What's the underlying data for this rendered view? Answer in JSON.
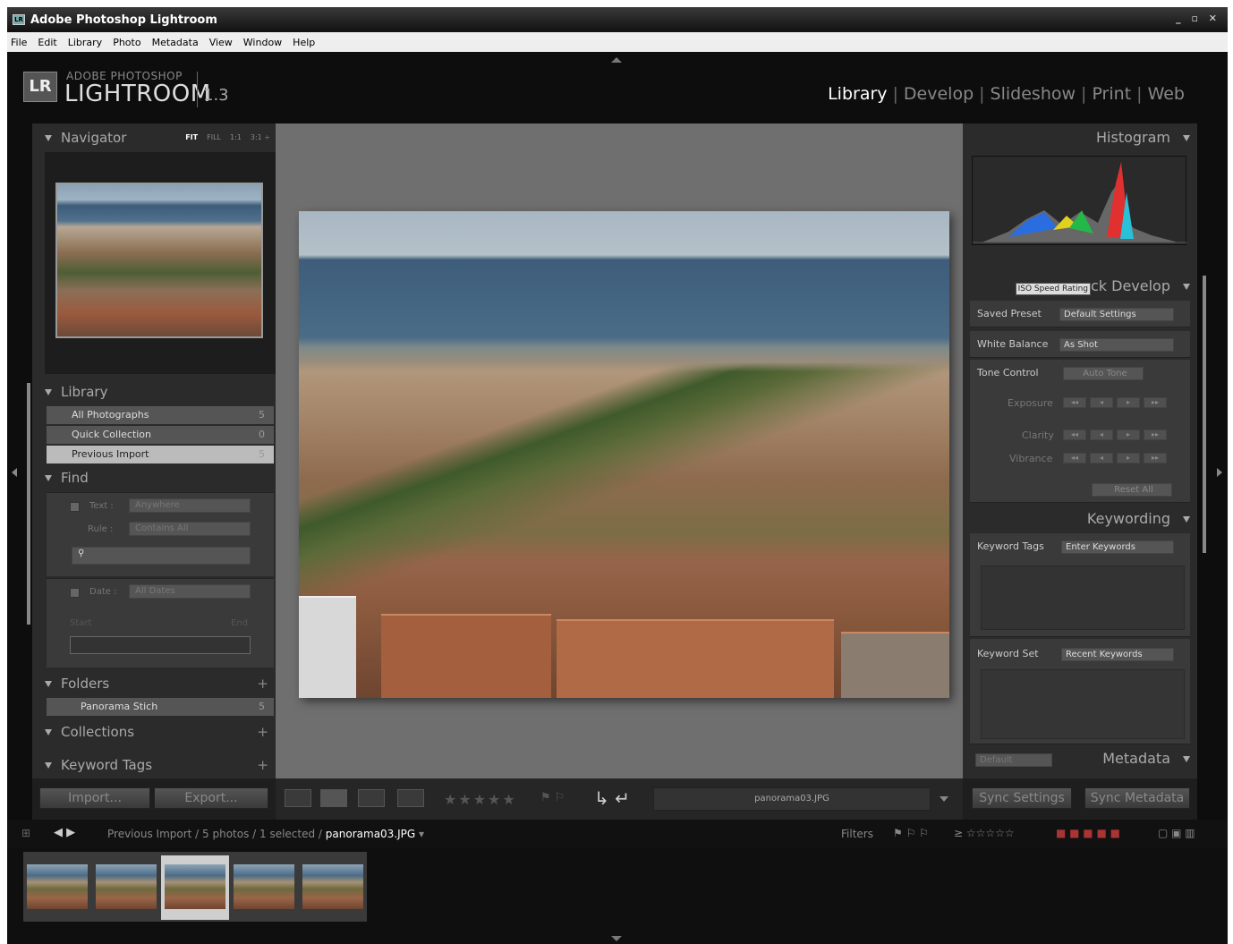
{
  "window": {
    "title": "Adobe Photoshop Lightroom",
    "app_icon_text": "LR",
    "controls": "_ ▫ ✕"
  },
  "menubar": [
    "File",
    "Edit",
    "Library",
    "Photo",
    "Metadata",
    "View",
    "Window",
    "Help"
  ],
  "header": {
    "logo_box": "LR",
    "logo_small": "ADOBE PHOTOSHOP",
    "logo_big": "LIGHTROOM",
    "version": "1.3",
    "modules": [
      "Library",
      "Develop",
      "Slideshow",
      "Print",
      "Web"
    ],
    "active_module": "Library",
    "separator": "|"
  },
  "left_panel": {
    "navigator": {
      "title": "Navigator",
      "options": [
        "FIT",
        "FILL",
        "1:1",
        "3:1 ÷"
      ]
    },
    "library": {
      "title": "Library",
      "items": [
        {
          "label": "All Photographs",
          "count": "5"
        },
        {
          "label": "Quick Collection",
          "count": "0"
        },
        {
          "label": "Previous Import",
          "count": "5"
        }
      ],
      "selected_index": 2
    },
    "find": {
      "title": "Find",
      "text_label": "Text :",
      "text_value": "Anywhere",
      "rule_label": "Rule :",
      "rule_value": "Contains All",
      "date_label": "Date :",
      "date_value": "All Dates",
      "start_label": "Start",
      "end_label": "End"
    },
    "folders": {
      "title": "Folders",
      "items": [
        {
          "label": "Panorama Stich",
          "count": "5"
        }
      ]
    },
    "collections": {
      "title": "Collections"
    },
    "keyword_tags": {
      "title": "Keyword Tags"
    },
    "plus": "+",
    "import_label": "Import...",
    "export_label": "Export..."
  },
  "toolbar": {
    "stars": "★★★★★",
    "flags": "⚑ ⚐",
    "rotate": "↳ ↵",
    "filename": "panorama03.JPG"
  },
  "right_panel": {
    "histogram": {
      "title": "Histogram"
    },
    "quick_develop": {
      "title": "ck Develop",
      "tooltip": "ISO Speed Rating",
      "saved_preset_label": "Saved Preset",
      "saved_preset_value": "Default Settings",
      "white_balance_label": "White Balance",
      "white_balance_value": "As Shot",
      "tone_control_label": "Tone Control",
      "auto_tone_label": "Auto Tone",
      "exposure_label": "Exposure",
      "clarity_label": "Clarity",
      "vibrance_label": "Vibrance",
      "reset_all_label": "Reset All",
      "step_buttons": [
        "◂◂",
        "◂",
        "▸",
        "▸▸"
      ]
    },
    "keywording": {
      "title": "Keywording",
      "keyword_tags_label": "Keyword Tags",
      "keyword_tags_value": "Enter Keywords",
      "keyword_set_label": "Keyword Set",
      "keyword_set_value": "Recent Keywords"
    },
    "metadata": {
      "title": "Metadata",
      "preset_value": "Default"
    },
    "sync_settings_label": "Sync Settings",
    "sync_metadata_label": "Sync Metadata"
  },
  "filmstrip_bar": {
    "path_prefix": "Previous Import / 5 photos / 1 selected / ",
    "current_file": "panorama03.JPG",
    "path_suffix": " ▾",
    "nav_arrows": "◀ ▶",
    "grid_icon": "⊞",
    "filters_label": "Filters",
    "filter_flags": "⚑ ⚐ ⚐",
    "filter_rating": "≥ ☆☆☆☆☆",
    "filter_colors": "■ ■ ■ ■ ■",
    "filter_tail": "▢ ▣ ▥"
  },
  "filmstrip": {
    "count": 5,
    "selected_index": 2
  },
  "colors": {
    "chrome": "#0f0f0f",
    "panel": "#2b2b2b",
    "center_bg": "#6f6f6f",
    "active_module": "#ffffff",
    "selected_row": "#bbbbbb"
  }
}
